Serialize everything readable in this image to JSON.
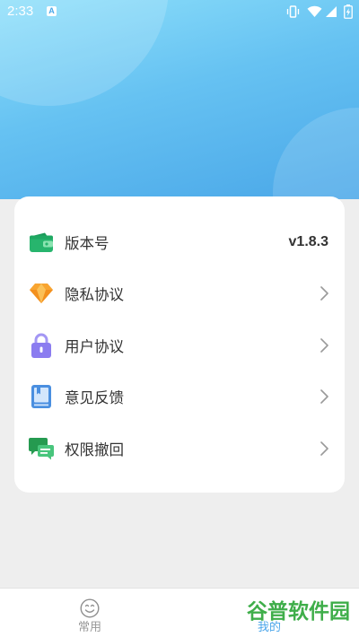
{
  "status_bar": {
    "time": "2:33",
    "notification_badge": "A",
    "icons": [
      "vibrate-icon",
      "wifi-icon",
      "signal-icon",
      "battery-charging-icon"
    ]
  },
  "header": {
    "gradient": [
      "#8ddffa",
      "#66c2f2",
      "#4aa7e8"
    ]
  },
  "menu": {
    "items": [
      {
        "icon": "wallet-icon",
        "label": "版本号",
        "value": "v1.8.3"
      },
      {
        "icon": "diamond-icon",
        "label": "隐私协议",
        "trailing": "chevron-right-icon"
      },
      {
        "icon": "lock-icon",
        "label": "用户协议",
        "trailing": "chevron-right-icon"
      },
      {
        "icon": "book-icon",
        "label": "意见反馈",
        "trailing": "chevron-right-icon"
      },
      {
        "icon": "chat-icon",
        "label": "权限撤回",
        "trailing": "chevron-right-icon"
      }
    ]
  },
  "bottom_nav": {
    "tabs": [
      {
        "icon": "smile-icon",
        "label": "常用",
        "active": false
      },
      {
        "label": "我的",
        "active": true
      }
    ]
  },
  "watermark": {
    "text": "谷普软件园"
  },
  "colors": {
    "page_background": "#eeeeee",
    "card_background": "#ffffff",
    "text_primary": "#333333",
    "text_inactive": "#999999",
    "accent": "#4aa5ea",
    "watermark": "#3fae4a"
  }
}
